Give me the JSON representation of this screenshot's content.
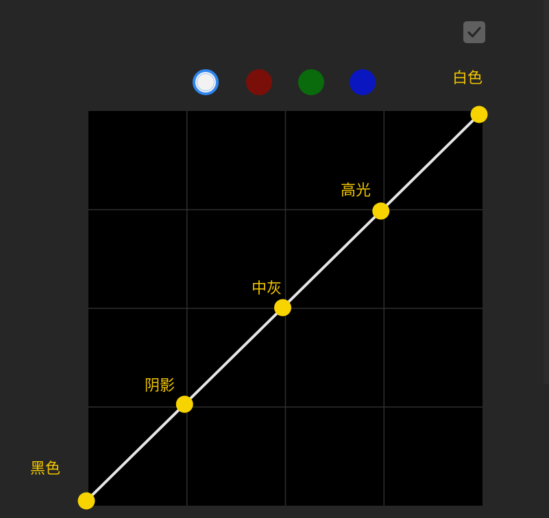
{
  "toggle": {
    "checked": true,
    "icon": "checkmark-icon"
  },
  "channels": [
    {
      "id": "rgb",
      "color": "#f2f2f2",
      "selected": true
    },
    {
      "id": "red",
      "color": "#7a0f0a",
      "selected": false
    },
    {
      "id": "green",
      "color": "#096b0c",
      "selected": false
    },
    {
      "id": "blue",
      "color": "#0a17c0",
      "selected": false
    }
  ],
  "curve": {
    "line_color": "#e6e6e6",
    "point_color": "#f7d400",
    "grid_color": "#2f2f2f",
    "background": "#000000",
    "points": [
      {
        "id": "black",
        "label": "黑色",
        "input": 0.0,
        "output": 0.0
      },
      {
        "id": "shadows",
        "label": "阴影",
        "input": 0.25,
        "output": 0.25
      },
      {
        "id": "midtones",
        "label": "中灰",
        "input": 0.5,
        "output": 0.5
      },
      {
        "id": "highlights",
        "label": "高光",
        "input": 0.75,
        "output": 0.75
      },
      {
        "id": "white",
        "label": "白色",
        "input": 1.0,
        "output": 1.0
      }
    ]
  }
}
